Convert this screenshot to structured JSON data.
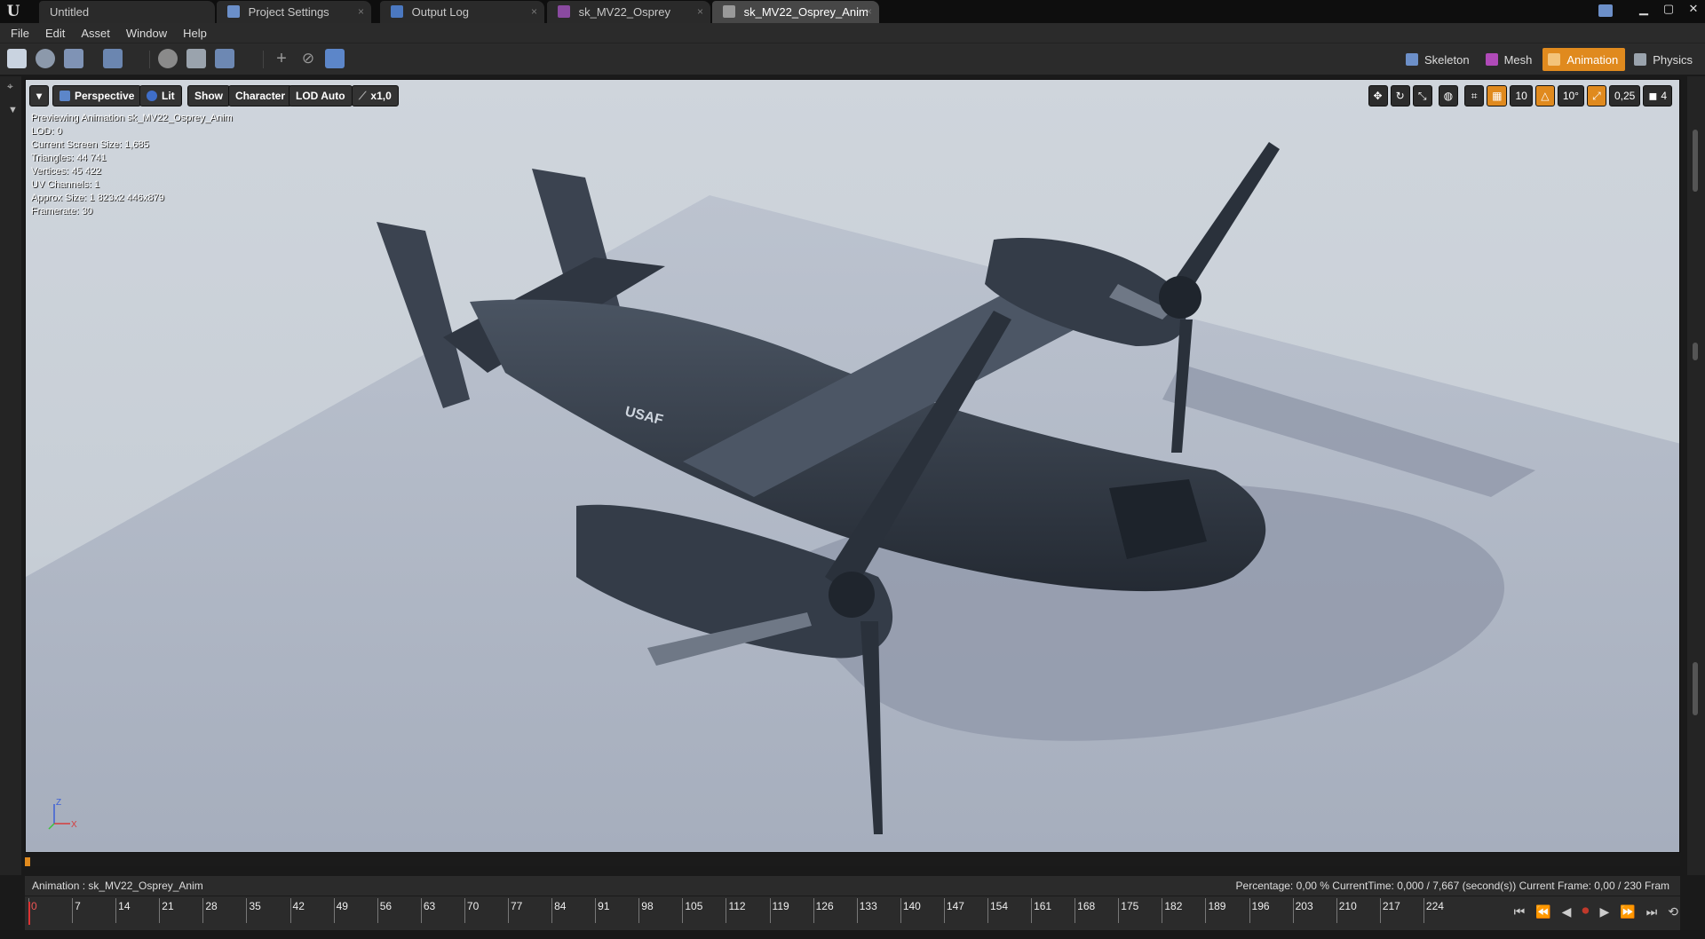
{
  "tabs": [
    {
      "label": "Untitled",
      "active": false
    },
    {
      "label": "Project Settings",
      "active": false
    },
    {
      "label": "Output Log",
      "active": false
    },
    {
      "label": "sk_MV22_Osprey",
      "active": false
    },
    {
      "label": "sk_MV22_Osprey_Anim",
      "active": true
    }
  ],
  "menu": {
    "file": "File",
    "edit": "Edit",
    "asset": "Asset",
    "window": "Window",
    "help": "Help"
  },
  "modes": {
    "skeleton": "Skeleton",
    "mesh": "Mesh",
    "animation": "Animation",
    "physics": "Physics"
  },
  "viewport_toolbar": {
    "perspective": "Perspective",
    "lit": "Lit",
    "show": "Show",
    "character": "Character",
    "lod": "LOD Auto",
    "speed": "x1,0"
  },
  "snap": {
    "grid": "10",
    "rotation": "10°",
    "scale": "0,25",
    "camera_speed": "4"
  },
  "stats": {
    "previewing": "Previewing Animation sk_MV22_Osprey_Anim",
    "lod": "LOD: 0",
    "screen_size": "Current Screen Size: 1,685",
    "triangles": "Triangles: 44 741",
    "vertices": "Vertices: 45 422",
    "uv_channels": "UV Channels: 1",
    "approx_size": "Approx Size: 1 823x2 446x879",
    "framerate": "Framerate: 30"
  },
  "aircraft": {
    "marking": "USAF"
  },
  "axis": {
    "z": "Z",
    "x": "X"
  },
  "animation_bar": {
    "name": "Animation :  sk_MV22_Osprey_Anim",
    "stats": "Percentage:  0,00 %  CurrentTime:  0,000 / 7,667 (second(s))  Current Frame:  0,00 / 230 Fram"
  },
  "timeline": {
    "ticks": [
      "0",
      "7",
      "14",
      "21",
      "28",
      "35",
      "42",
      "49",
      "56",
      "63",
      "70",
      "77",
      "84",
      "91",
      "98",
      "105",
      "112",
      "119",
      "126",
      "133",
      "140",
      "147",
      "154",
      "161",
      "168",
      "175",
      "182",
      "189",
      "196",
      "203",
      "210",
      "217",
      "224"
    ]
  },
  "colors": {
    "accent": "#e08a1e",
    "record": "#c0392b"
  }
}
